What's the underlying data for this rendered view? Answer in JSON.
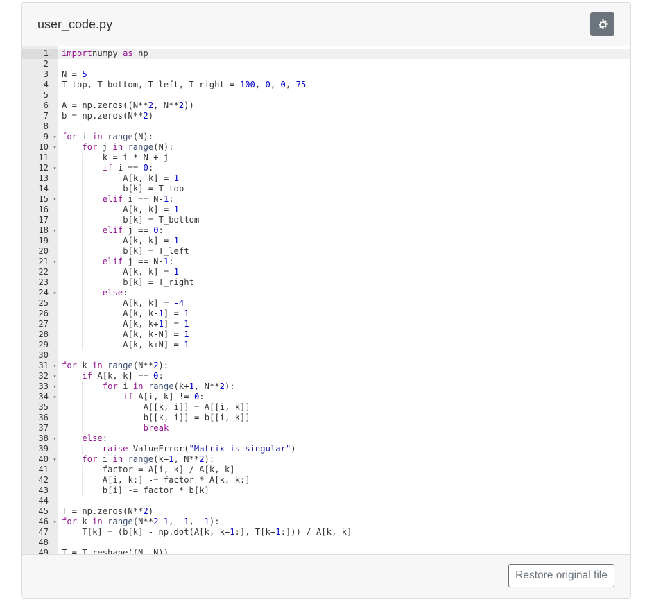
{
  "header": {
    "file_name": "user_code.py",
    "settings_icon": "gear-icon"
  },
  "footer": {
    "restore_label": "Restore original file"
  },
  "colors": {
    "keyword": "#931393",
    "number": "#0000cd",
    "string": "#1a1aa6",
    "button_gray": "#6c757d"
  },
  "editor": {
    "lines": [
      {
        "n": "1",
        "fold": false,
        "active": true,
        "indent": 0,
        "tokens": [
          [
            "kw",
            "import"
          ],
          [
            "",
            "numpy "
          ],
          [
            "kw",
            "as"
          ],
          [
            "",
            " np"
          ]
        ]
      },
      {
        "n": "2",
        "fold": false,
        "indent": 0,
        "tokens": []
      },
      {
        "n": "3",
        "fold": false,
        "indent": 0,
        "tokens": [
          [
            "",
            "N = "
          ],
          [
            "num",
            "5"
          ]
        ]
      },
      {
        "n": "4",
        "fold": false,
        "indent": 0,
        "tokens": [
          [
            "",
            "T_top, T_bottom, T_left, T_right = "
          ],
          [
            "num",
            "100"
          ],
          [
            "",
            ", "
          ],
          [
            "num",
            "0"
          ],
          [
            "",
            ", "
          ],
          [
            "num",
            "0"
          ],
          [
            "",
            ", "
          ],
          [
            "num",
            "75"
          ]
        ]
      },
      {
        "n": "5",
        "fold": false,
        "indent": 0,
        "tokens": []
      },
      {
        "n": "6",
        "fold": false,
        "indent": 0,
        "tokens": [
          [
            "",
            "A = np.zeros((N**"
          ],
          [
            "num",
            "2"
          ],
          [
            "",
            ", N**"
          ],
          [
            "num",
            "2"
          ],
          [
            "",
            "))"
          ]
        ]
      },
      {
        "n": "7",
        "fold": false,
        "indent": 0,
        "tokens": [
          [
            "",
            "b = np.zeros(N**"
          ],
          [
            "num",
            "2"
          ],
          [
            "",
            ")"
          ]
        ]
      },
      {
        "n": "8",
        "fold": false,
        "indent": 0,
        "tokens": []
      },
      {
        "n": "9",
        "fold": true,
        "indent": 0,
        "tokens": [
          [
            "kw",
            "for"
          ],
          [
            "",
            " i "
          ],
          [
            "kw",
            "in"
          ],
          [
            "",
            " "
          ],
          [
            "fn",
            "range"
          ],
          [
            "",
            "(N):"
          ]
        ]
      },
      {
        "n": "10",
        "fold": true,
        "indent": 1,
        "tokens": [
          [
            "kw",
            "for"
          ],
          [
            "",
            " j "
          ],
          [
            "kw",
            "in"
          ],
          [
            "",
            " "
          ],
          [
            "fn",
            "range"
          ],
          [
            "",
            "(N):"
          ]
        ]
      },
      {
        "n": "11",
        "fold": false,
        "indent": 2,
        "tokens": [
          [
            "",
            "k = i * N + j"
          ]
        ]
      },
      {
        "n": "12",
        "fold": true,
        "indent": 2,
        "tokens": [
          [
            "kw",
            "if"
          ],
          [
            "",
            " i == "
          ],
          [
            "num",
            "0"
          ],
          [
            "",
            ":"
          ]
        ]
      },
      {
        "n": "13",
        "fold": false,
        "indent": 3,
        "tokens": [
          [
            "",
            "A[k, k] = "
          ],
          [
            "num",
            "1"
          ]
        ]
      },
      {
        "n": "14",
        "fold": false,
        "indent": 3,
        "tokens": [
          [
            "",
            "b[k] = T_top"
          ]
        ]
      },
      {
        "n": "15",
        "fold": true,
        "indent": 2,
        "tokens": [
          [
            "kw",
            "elif"
          ],
          [
            "",
            " i == N-"
          ],
          [
            "num",
            "1"
          ],
          [
            "",
            ":"
          ]
        ]
      },
      {
        "n": "16",
        "fold": false,
        "indent": 3,
        "tokens": [
          [
            "",
            "A[k, k] = "
          ],
          [
            "num",
            "1"
          ]
        ]
      },
      {
        "n": "17",
        "fold": false,
        "indent": 3,
        "tokens": [
          [
            "",
            "b[k] = T_bottom"
          ]
        ]
      },
      {
        "n": "18",
        "fold": true,
        "indent": 2,
        "tokens": [
          [
            "kw",
            "elif"
          ],
          [
            "",
            " j == "
          ],
          [
            "num",
            "0"
          ],
          [
            "",
            ":"
          ]
        ]
      },
      {
        "n": "19",
        "fold": false,
        "indent": 3,
        "tokens": [
          [
            "",
            "A[k, k] = "
          ],
          [
            "num",
            "1"
          ]
        ]
      },
      {
        "n": "20",
        "fold": false,
        "indent": 3,
        "tokens": [
          [
            "",
            "b[k] = T_left"
          ]
        ]
      },
      {
        "n": "21",
        "fold": true,
        "indent": 2,
        "tokens": [
          [
            "kw",
            "elif"
          ],
          [
            "",
            " j == N-"
          ],
          [
            "num",
            "1"
          ],
          [
            "",
            ":"
          ]
        ]
      },
      {
        "n": "22",
        "fold": false,
        "indent": 3,
        "tokens": [
          [
            "",
            "A[k, k] = "
          ],
          [
            "num",
            "1"
          ]
        ]
      },
      {
        "n": "23",
        "fold": false,
        "indent": 3,
        "tokens": [
          [
            "",
            "b[k] = T_right"
          ]
        ]
      },
      {
        "n": "24",
        "fold": true,
        "indent": 2,
        "tokens": [
          [
            "kw",
            "else"
          ],
          [
            "",
            ":"
          ]
        ]
      },
      {
        "n": "25",
        "fold": false,
        "indent": 3,
        "tokens": [
          [
            "",
            "A[k, k] = "
          ],
          [
            "num",
            "-4"
          ]
        ]
      },
      {
        "n": "26",
        "fold": false,
        "indent": 3,
        "tokens": [
          [
            "",
            "A[k, k-"
          ],
          [
            "num",
            "1"
          ],
          [
            "",
            "] = "
          ],
          [
            "num",
            "1"
          ]
        ]
      },
      {
        "n": "27",
        "fold": false,
        "indent": 3,
        "tokens": [
          [
            "",
            "A[k, k+"
          ],
          [
            "num",
            "1"
          ],
          [
            "",
            "] = "
          ],
          [
            "num",
            "1"
          ]
        ]
      },
      {
        "n": "28",
        "fold": false,
        "indent": 3,
        "tokens": [
          [
            "",
            "A[k, k-N] = "
          ],
          [
            "num",
            "1"
          ]
        ]
      },
      {
        "n": "29",
        "fold": false,
        "indent": 3,
        "tokens": [
          [
            "",
            "A[k, k+N] = "
          ],
          [
            "num",
            "1"
          ]
        ]
      },
      {
        "n": "30",
        "fold": false,
        "indent": 0,
        "tokens": []
      },
      {
        "n": "31",
        "fold": true,
        "indent": 0,
        "tokens": [
          [
            "kw",
            "for"
          ],
          [
            "",
            " k "
          ],
          [
            "kw",
            "in"
          ],
          [
            "",
            " "
          ],
          [
            "fn",
            "range"
          ],
          [
            "",
            "(N**"
          ],
          [
            "num",
            "2"
          ],
          [
            "",
            "):"
          ]
        ]
      },
      {
        "n": "32",
        "fold": true,
        "indent": 1,
        "tokens": [
          [
            "kw",
            "if"
          ],
          [
            "",
            " A[k, k] == "
          ],
          [
            "num",
            "0"
          ],
          [
            "",
            ":"
          ]
        ]
      },
      {
        "n": "33",
        "fold": true,
        "indent": 2,
        "tokens": [
          [
            "kw",
            "for"
          ],
          [
            "",
            " i "
          ],
          [
            "kw",
            "in"
          ],
          [
            "",
            " "
          ],
          [
            "fn",
            "range"
          ],
          [
            "",
            "(k+"
          ],
          [
            "num",
            "1"
          ],
          [
            "",
            ", N**"
          ],
          [
            "num",
            "2"
          ],
          [
            "",
            "):"
          ]
        ]
      },
      {
        "n": "34",
        "fold": true,
        "indent": 3,
        "tokens": [
          [
            "kw",
            "if"
          ],
          [
            "",
            " A[i, k] != "
          ],
          [
            "num",
            "0"
          ],
          [
            "",
            ":"
          ]
        ]
      },
      {
        "n": "35",
        "fold": false,
        "indent": 4,
        "tokens": [
          [
            "",
            "A[[k, i]] = A[[i, k]]"
          ]
        ]
      },
      {
        "n": "36",
        "fold": false,
        "indent": 4,
        "tokens": [
          [
            "",
            "b[[k, i]] = b[[i, k]]"
          ]
        ]
      },
      {
        "n": "37",
        "fold": false,
        "indent": 4,
        "tokens": [
          [
            "kw",
            "break"
          ]
        ]
      },
      {
        "n": "38",
        "fold": true,
        "indent": 1,
        "tokens": [
          [
            "kw",
            "else"
          ],
          [
            "",
            ":"
          ]
        ]
      },
      {
        "n": "39",
        "fold": false,
        "indent": 2,
        "tokens": [
          [
            "kw",
            "raise"
          ],
          [
            "",
            " ValueError("
          ],
          [
            "str",
            "\"Matrix is singular\""
          ],
          [
            "",
            ")"
          ]
        ]
      },
      {
        "n": "40",
        "fold": true,
        "indent": 1,
        "tokens": [
          [
            "kw",
            "for"
          ],
          [
            "",
            " i "
          ],
          [
            "kw",
            "in"
          ],
          [
            "",
            " "
          ],
          [
            "fn",
            "range"
          ],
          [
            "",
            "(k+"
          ],
          [
            "num",
            "1"
          ],
          [
            "",
            ", N**"
          ],
          [
            "num",
            "2"
          ],
          [
            "",
            "):"
          ]
        ]
      },
      {
        "n": "41",
        "fold": false,
        "indent": 2,
        "tokens": [
          [
            "",
            "factor = A[i, k] / A[k, k]"
          ]
        ]
      },
      {
        "n": "42",
        "fold": false,
        "indent": 2,
        "tokens": [
          [
            "",
            "A[i, k:] -= factor * A[k, k:]"
          ]
        ]
      },
      {
        "n": "43",
        "fold": false,
        "indent": 2,
        "tokens": [
          [
            "",
            "b[i] -= factor * b[k]"
          ]
        ]
      },
      {
        "n": "44",
        "fold": false,
        "indent": 0,
        "tokens": []
      },
      {
        "n": "45",
        "fold": false,
        "indent": 0,
        "tokens": [
          [
            "",
            "T = np.zeros(N**"
          ],
          [
            "num",
            "2"
          ],
          [
            "",
            ")"
          ]
        ]
      },
      {
        "n": "46",
        "fold": true,
        "indent": 0,
        "tokens": [
          [
            "kw",
            "for"
          ],
          [
            "",
            " k "
          ],
          [
            "kw",
            "in"
          ],
          [
            "",
            " "
          ],
          [
            "fn",
            "range"
          ],
          [
            "",
            "(N**"
          ],
          [
            "num",
            "2"
          ],
          [
            "",
            "-"
          ],
          [
            "num",
            "1"
          ],
          [
            "",
            ", "
          ],
          [
            "num",
            "-1"
          ],
          [
            "",
            ", "
          ],
          [
            "num",
            "-1"
          ],
          [
            "",
            "):"
          ]
        ]
      },
      {
        "n": "47",
        "fold": false,
        "indent": 1,
        "tokens": [
          [
            "",
            "T[k] = (b[k] - np.dot(A[k, k+"
          ],
          [
            "num",
            "1"
          ],
          [
            "",
            ":], T[k+"
          ],
          [
            "num",
            "1"
          ],
          [
            "",
            ":])) / A[k, k]"
          ]
        ]
      },
      {
        "n": "48",
        "fold": false,
        "indent": 0,
        "tokens": []
      },
      {
        "n": "49",
        "fold": false,
        "indent": 0,
        "tokens": [
          [
            "",
            "T = T.reshape((N, N))"
          ]
        ]
      }
    ]
  }
}
